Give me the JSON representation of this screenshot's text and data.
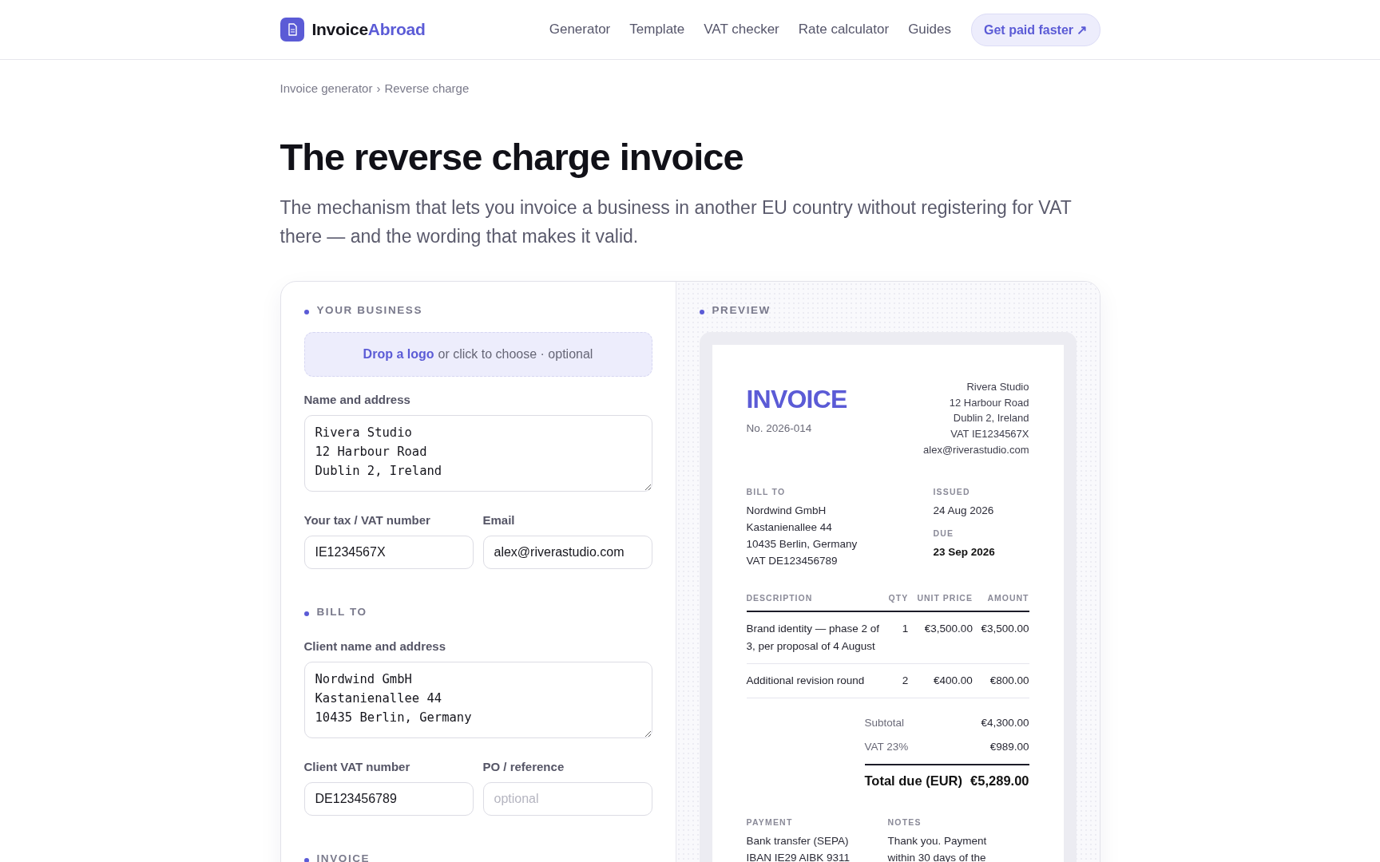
{
  "header": {
    "brand": {
      "first": "Invoice",
      "second": "Abroad"
    },
    "nav": [
      {
        "label": "Generator"
      },
      {
        "label": "Template"
      },
      {
        "label": "VAT checker"
      },
      {
        "label": "Rate calculator"
      },
      {
        "label": "Guides"
      }
    ],
    "cta": "Get paid faster ↗"
  },
  "breadcrumb": {
    "items": [
      "Invoice generator",
      "Reverse charge"
    ],
    "separator": "›"
  },
  "title": "The reverse charge invoice",
  "subtitle": "The mechanism that lets you invoice a business in another EU country without registering for VAT there — and the wording that makes it valid.",
  "form": {
    "sections": [
      {
        "heading": "YOUR BUSINESS",
        "drop_zone": {
          "link": "Drop a logo",
          "text": "or click to choose · optional"
        },
        "rows": [
          [
            {
              "kind": "textarea",
              "label": "Name and address",
              "value": "Rivera Studio\n12 Harbour Road\nDublin 2, Ireland"
            }
          ],
          [
            {
              "kind": "input",
              "label": "Your tax / VAT number",
              "value": "IE1234567X"
            },
            {
              "kind": "input",
              "label": "Email",
              "value": "alex@riverastudio.com"
            }
          ]
        ]
      },
      {
        "heading": "BILL TO",
        "rows": [
          [
            {
              "kind": "textarea",
              "label": "Client name and address",
              "value": "Nordwind GmbH\nKastanienallee 44\n10435 Berlin, Germany"
            }
          ],
          [
            {
              "kind": "input",
              "label": "Client VAT number",
              "value": "DE123456789"
            },
            {
              "kind": "input",
              "label": "PO / reference",
              "placeholder": "optional"
            }
          ]
        ]
      },
      {
        "heading": "INVOICE"
      }
    ]
  },
  "preview": {
    "heading": "PREVIEW",
    "invoice": {
      "title": "INVOICE",
      "number": "No. 2026-014",
      "from_lines": [
        "Rivera Studio",
        "12 Harbour Road",
        "Dublin 2, Ireland",
        "VAT IE1234567X",
        "alex@riverastudio.com"
      ],
      "bill_to": {
        "label": "BILL TO",
        "lines": [
          "Nordwind GmbH",
          "Kastanienallee 44",
          "10435 Berlin, Germany",
          "VAT DE123456789"
        ]
      },
      "issued": {
        "label": "ISSUED",
        "value": "24 Aug 2026"
      },
      "due": {
        "label": "DUE",
        "value": "23 Sep 2026"
      },
      "columns": [
        "DESCRIPTION",
        "QTY",
        "UNIT PRICE",
        "AMOUNT"
      ],
      "items": [
        {
          "description": "Brand identity — phase 2 of 3, per proposal of 4 August",
          "qty": "1",
          "unit_price": "€3,500.00",
          "amount": "€3,500.00"
        },
        {
          "description": "Additional revision round",
          "qty": "2",
          "unit_price": "€400.00",
          "amount": "€800.00"
        }
      ],
      "totals": [
        {
          "label": "Subtotal",
          "value": "€4,300.00"
        },
        {
          "label": "VAT 23%",
          "value": "€989.00"
        }
      ],
      "total": {
        "label": "Total due (EUR)",
        "value": "€5,289.00"
      },
      "payment": {
        "label": "PAYMENT",
        "lines": [
          "Bank transfer (SEPA)",
          "IBAN IE29 AIBK 9311"
        ]
      },
      "notes": {
        "label": "NOTES",
        "lines": [
          "Thank you. Payment",
          "within 30 days of the"
        ]
      }
    }
  }
}
